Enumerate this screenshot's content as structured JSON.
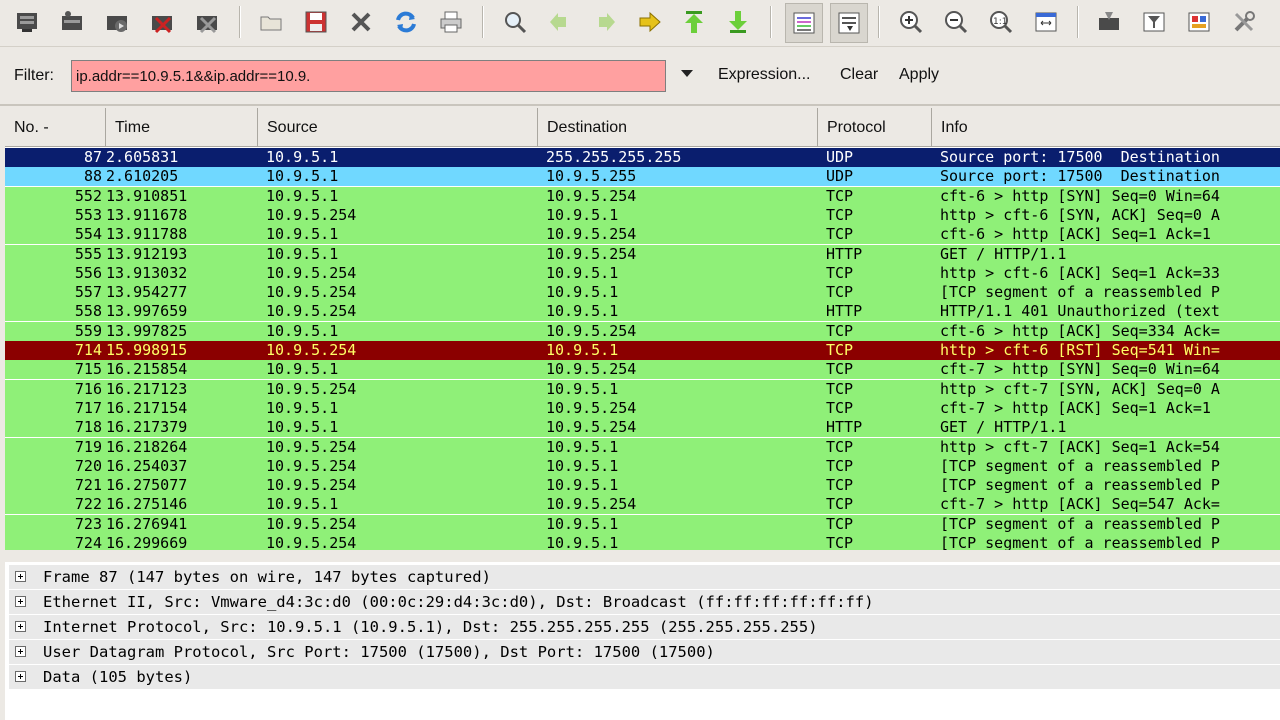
{
  "toolbar": {
    "icons": [
      "interface-list-icon",
      "capture-options-icon",
      "start-capture-icon",
      "stop-capture-icon",
      "restart-capture-icon",
      "open-file-icon",
      "save-file-icon",
      "close-file-icon",
      "reload-icon",
      "print-icon",
      "find-packet-icon",
      "go-back-icon",
      "go-forward-icon",
      "go-to-packet-icon",
      "first-packet-icon",
      "last-packet-icon",
      "colorize-icon",
      "auto-scroll-icon",
      "zoom-in-icon",
      "zoom-out-icon",
      "normal-size-icon",
      "resize-columns-icon",
      "capture-filters-icon",
      "display-filters-icon",
      "coloring-rules-icon",
      "preferences-icon"
    ]
  },
  "filter": {
    "label": "Filter:",
    "value": "ip.addr==10.9.5.1&&ip.addr==10.9.",
    "expression_label": "Expression...",
    "clear_label": "Clear",
    "apply_label": "Apply"
  },
  "packet_list": {
    "columns": [
      "No. -",
      "Time",
      "Source",
      "Destination",
      "Protocol",
      "Info"
    ],
    "rows": [
      {
        "no": "87",
        "time": "2.605831",
        "src": "10.9.5.1",
        "dst": "255.255.255.255",
        "proto": "UDP",
        "info": "Source port: 17500  Destination",
        "style": "selected"
      },
      {
        "no": "88",
        "time": "2.610205",
        "src": "10.9.5.1",
        "dst": "10.9.5.255",
        "proto": "UDP",
        "info": "Source port: 17500  Destination",
        "style": "udp"
      },
      {
        "no": "552",
        "time": "13.910851",
        "src": "10.9.5.1",
        "dst": "10.9.5.254",
        "proto": "TCP",
        "info": "cft-6 > http [SYN] Seq=0 Win=64",
        "style": "tcp"
      },
      {
        "no": "553",
        "time": "13.911678",
        "src": "10.9.5.254",
        "dst": "10.9.5.1",
        "proto": "TCP",
        "info": "http > cft-6 [SYN, ACK] Seq=0 A",
        "style": "tcp"
      },
      {
        "no": "554",
        "time": "13.911788",
        "src": "10.9.5.1",
        "dst": "10.9.5.254",
        "proto": "TCP",
        "info": "cft-6 > http [ACK] Seq=1 Ack=1",
        "style": "tcp"
      },
      {
        "no": "555",
        "time": "13.912193",
        "src": "10.9.5.1",
        "dst": "10.9.5.254",
        "proto": "HTTP",
        "info": "GET / HTTP/1.1",
        "style": "tcp"
      },
      {
        "no": "556",
        "time": "13.913032",
        "src": "10.9.5.254",
        "dst": "10.9.5.1",
        "proto": "TCP",
        "info": "http > cft-6 [ACK] Seq=1 Ack=33",
        "style": "tcp"
      },
      {
        "no": "557",
        "time": "13.954277",
        "src": "10.9.5.254",
        "dst": "10.9.5.1",
        "proto": "TCP",
        "info": "[TCP segment of a reassembled P",
        "style": "tcp"
      },
      {
        "no": "558",
        "time": "13.997659",
        "src": "10.9.5.254",
        "dst": "10.9.5.1",
        "proto": "HTTP",
        "info": "HTTP/1.1 401 Unauthorized (text",
        "style": "tcp"
      },
      {
        "no": "559",
        "time": "13.997825",
        "src": "10.9.5.1",
        "dst": "10.9.5.254",
        "proto": "TCP",
        "info": "cft-6 > http [ACK] Seq=334 Ack=",
        "style": "tcp"
      },
      {
        "no": "714",
        "time": "15.998915",
        "src": "10.9.5.254",
        "dst": "10.9.5.1",
        "proto": "TCP",
        "info": "http > cft-6 [RST] Seq=541 Win=",
        "style": "rst"
      },
      {
        "no": "715",
        "time": "16.215854",
        "src": "10.9.5.1",
        "dst": "10.9.5.254",
        "proto": "TCP",
        "info": "cft-7 > http [SYN] Seq=0 Win=64",
        "style": "tcp"
      },
      {
        "no": "716",
        "time": "16.217123",
        "src": "10.9.5.254",
        "dst": "10.9.5.1",
        "proto": "TCP",
        "info": "http > cft-7 [SYN, ACK] Seq=0 A",
        "style": "tcp"
      },
      {
        "no": "717",
        "time": "16.217154",
        "src": "10.9.5.1",
        "dst": "10.9.5.254",
        "proto": "TCP",
        "info": "cft-7 > http [ACK] Seq=1 Ack=1",
        "style": "tcp"
      },
      {
        "no": "718",
        "time": "16.217379",
        "src": "10.9.5.1",
        "dst": "10.9.5.254",
        "proto": "HTTP",
        "info": "GET / HTTP/1.1",
        "style": "tcp"
      },
      {
        "no": "719",
        "time": "16.218264",
        "src": "10.9.5.254",
        "dst": "10.9.5.1",
        "proto": "TCP",
        "info": "http > cft-7 [ACK] Seq=1 Ack=54",
        "style": "tcp"
      },
      {
        "no": "720",
        "time": "16.254037",
        "src": "10.9.5.254",
        "dst": "10.9.5.1",
        "proto": "TCP",
        "info": "[TCP segment of a reassembled P",
        "style": "tcp"
      },
      {
        "no": "721",
        "time": "16.275077",
        "src": "10.9.5.254",
        "dst": "10.9.5.1",
        "proto": "TCP",
        "info": "[TCP segment of a reassembled P",
        "style": "tcp"
      },
      {
        "no": "722",
        "time": "16.275146",
        "src": "10.9.5.1",
        "dst": "10.9.5.254",
        "proto": "TCP",
        "info": "cft-7 > http [ACK] Seq=547 Ack=",
        "style": "tcp"
      },
      {
        "no": "723",
        "time": "16.276941",
        "src": "10.9.5.254",
        "dst": "10.9.5.1",
        "proto": "TCP",
        "info": "[TCP segment of a reassembled P",
        "style": "tcp"
      },
      {
        "no": "724",
        "time": "16.299669",
        "src": "10.9.5.254",
        "dst": "10.9.5.1",
        "proto": "TCP",
        "info": "[TCP segment of a reassembled P",
        "style": "tcp"
      }
    ]
  },
  "details": [
    "Frame 87 (147 bytes on wire, 147 bytes captured)",
    "Ethernet II, Src: Vmware_d4:3c:d0 (00:0c:29:d4:3c:d0), Dst: Broadcast (ff:ff:ff:ff:ff:ff)",
    "Internet Protocol, Src: 10.9.5.1 (10.9.5.1), Dst: 255.255.255.255 (255.255.255.255)",
    "User Datagram Protocol, Src Port: 17500 (17500), Dst Port: 17500 (17500)",
    "Data (105 bytes)"
  ],
  "colors": {
    "selected_bg": "#0a1e6e",
    "selected_fg": "#ffffff",
    "udp_bg": "#70d8ff",
    "tcp_bg": "#8ff078",
    "rst_bg": "#8b0000",
    "rst_fg": "#ffff66",
    "filter_invalid_bg": "#ffa0a0"
  }
}
